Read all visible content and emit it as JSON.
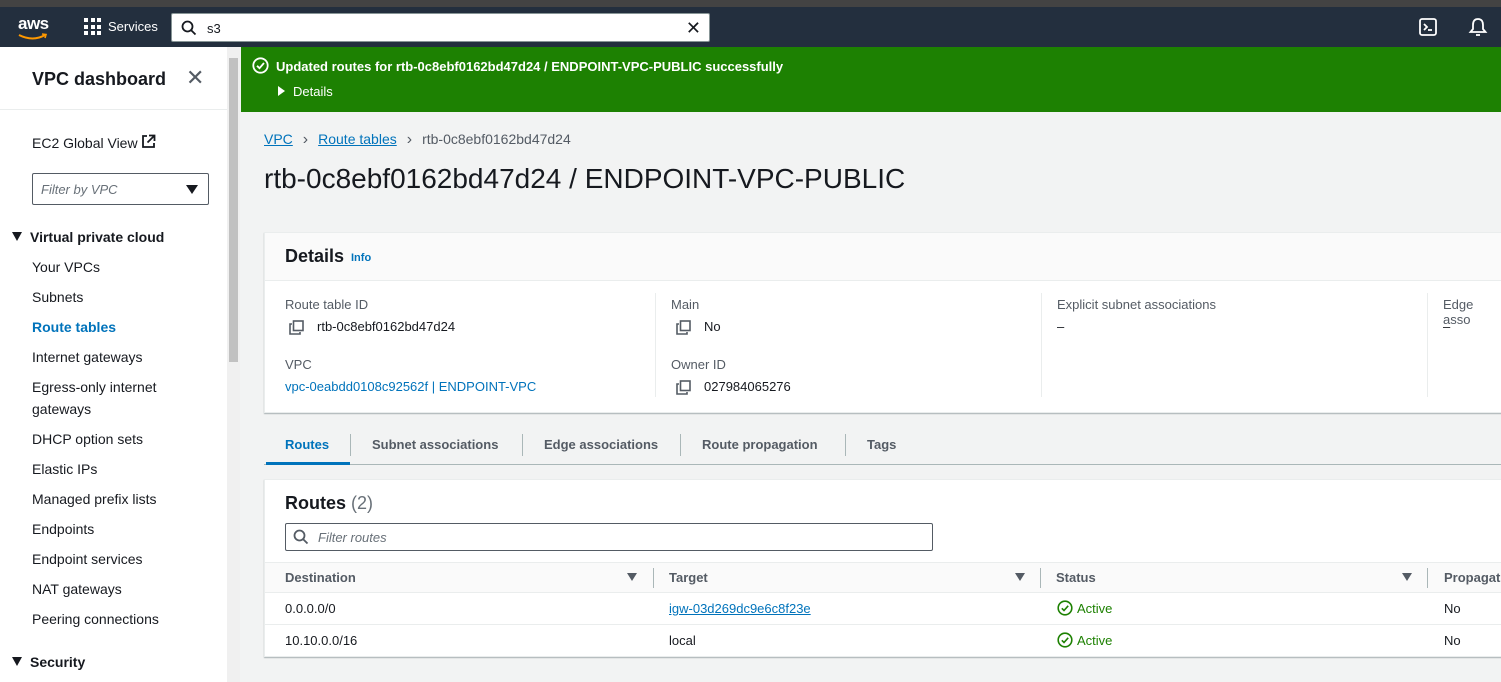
{
  "topnav": {
    "logo_text": "aws",
    "services_label": "Services",
    "search_value": "s3"
  },
  "sidebar": {
    "title": "VPC dashboard",
    "ec2_global_view": "EC2 Global View",
    "filter_placeholder": "Filter by VPC",
    "section_vpc": "Virtual private cloud",
    "items": [
      {
        "label": "Your VPCs"
      },
      {
        "label": "Subnets"
      },
      {
        "label": "Route tables"
      },
      {
        "label": "Internet gateways"
      },
      {
        "label": "Egress-only internet gateways"
      },
      {
        "label": "DHCP option sets"
      },
      {
        "label": "Elastic IPs"
      },
      {
        "label": "Managed prefix lists"
      },
      {
        "label": "Endpoints"
      },
      {
        "label": "Endpoint services"
      },
      {
        "label": "NAT gateways"
      },
      {
        "label": "Peering connections"
      }
    ],
    "section_security": "Security"
  },
  "flash": {
    "message": "Updated routes for rtb-0c8ebf0162bd47d24 / ENDPOINT-VPC-PUBLIC successfully",
    "details_label": "Details"
  },
  "breadcrumb": {
    "vpc": "VPC",
    "route_tables": "Route tables",
    "current": "rtb-0c8ebf0162bd47d24"
  },
  "page_title": "rtb-0c8ebf0162bd47d24 / ENDPOINT-VPC-PUBLIC",
  "details": {
    "heading": "Details",
    "info": "Info",
    "route_table_id_label": "Route table ID",
    "route_table_id": "rtb-0c8ebf0162bd47d24",
    "main_label": "Main",
    "main": "No",
    "explicit_label": "Explicit subnet associations",
    "explicit": "–",
    "edge_label": "Edge asso",
    "edge": "–",
    "vpc_label": "VPC",
    "vpc": "vpc-0eabdd0108c92562f | ENDPOINT-VPC",
    "owner_label": "Owner ID",
    "owner": "027984065276"
  },
  "tabs": [
    {
      "label": "Routes"
    },
    {
      "label": "Subnet associations"
    },
    {
      "label": "Edge associations"
    },
    {
      "label": "Route propagation"
    },
    {
      "label": "Tags"
    }
  ],
  "routes": {
    "heading": "Routes",
    "count": "(2)",
    "filter_placeholder": "Filter routes",
    "columns": [
      "Destination",
      "Target",
      "Status",
      "Propagat"
    ],
    "rows": [
      {
        "destination": "0.0.0.0/0",
        "target": "igw-03d269dc9e6c8f23e",
        "status": "Active",
        "propagated": "No"
      },
      {
        "destination": "10.10.0.0/16",
        "target": "local",
        "status": "Active",
        "propagated": "No"
      }
    ]
  },
  "colors": {
    "nav_bg": "#232f3e",
    "flash_success": "#1d8102",
    "link": "#0073bb",
    "status_active": "#1d8102"
  }
}
